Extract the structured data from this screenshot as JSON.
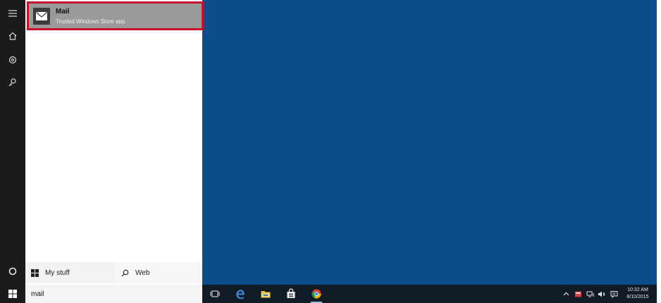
{
  "search_results": [
    {
      "title": "Mail",
      "subtitle": "Trusted Windows Store app",
      "icon": "mail-icon"
    }
  ],
  "scopes": {
    "my_stuff": "My stuff",
    "web": "Web"
  },
  "search": {
    "value": "mail"
  },
  "rail": {
    "items": [
      "hamburger-menu-icon",
      "home-icon",
      "settings-icon",
      "feedback-icon",
      "cortana-circle-icon"
    ]
  },
  "taskbar": {
    "apps": [
      "task-view-icon",
      "edge-icon",
      "file-explorer-icon",
      "store-icon",
      "chrome-icon"
    ]
  },
  "clock": {
    "time": "10:32 AM",
    "date": "8/10/2015"
  },
  "colors": {
    "desktop": "#0b4e8a",
    "highlight_border": "#c8102e",
    "taskbar": "#101b26"
  }
}
